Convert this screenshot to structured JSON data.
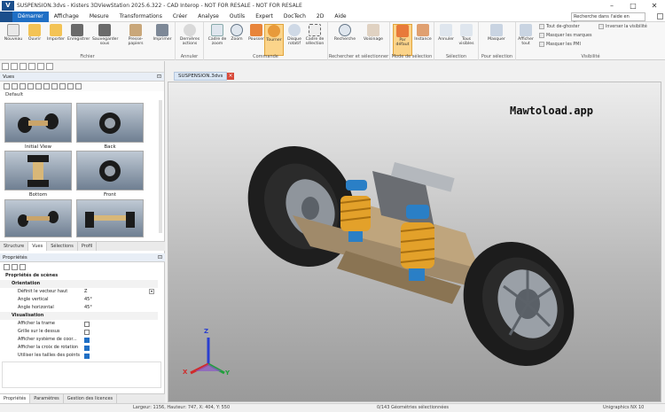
{
  "window": {
    "title": "SUSPENSION.3dvs - Kisters 3DViewStation 2025.6.322 - CAD Interop - NOT FOR RESALE - NOT FOR RESALE",
    "logo": "V",
    "controls": [
      "–",
      "□",
      "✕"
    ]
  },
  "menu": {
    "tabs": [
      "Démarrer",
      "Affichage",
      "Mesure",
      "Transformations",
      "Créer",
      "Analyse",
      "Outils",
      "Expert",
      "DocTech",
      "2D",
      "Aide"
    ],
    "search": "Recherche dans l'aide en ligne..."
  },
  "ribbon": {
    "fichier": {
      "label": "Fichier",
      "buttons": [
        "Nouveau",
        "Ouvrir",
        "Importer",
        "Enregistrer",
        "Sauvegarder sous",
        "Presse-papiers",
        "Imprimer"
      ]
    },
    "annuler": {
      "label": "Annuler",
      "buttons": [
        "Dernières actions"
      ]
    },
    "commande": {
      "label": "Commande",
      "buttons": [
        "Cadre de zoom",
        "Zoom",
        "Pousser",
        "Tourner",
        "Disque rotatif",
        "Cadre de sélection"
      ]
    },
    "recherche": {
      "label": "Rechercher et sélectionner",
      "buttons": [
        "Recherche",
        "Voisinage"
      ]
    },
    "mode": {
      "label": "Mode de sélection",
      "buttons": [
        "Par défaut",
        "Instance"
      ]
    },
    "selection": {
      "label": "Sélection",
      "buttons": [
        "Annuler",
        "Tous visibles"
      ]
    },
    "pour_selection": {
      "label": "Pour sélection",
      "buttons": [
        "Masquer"
      ]
    },
    "visibilite": {
      "label": "Visibilité",
      "buttons": [
        "Afficher tout"
      ],
      "items": [
        "Tout de-ghoster",
        "Masquer les marques",
        "Masquer les PMI",
        "Inverser la visibilité"
      ]
    }
  },
  "left": {
    "views_header": "Vues",
    "default_label": "Default",
    "thumbs": [
      "Initial View",
      "Back",
      "Bottom",
      "Front",
      "",
      ""
    ],
    "tabs": [
      "Structure",
      "Vues",
      "Sélections",
      "Profil"
    ]
  },
  "props": {
    "header": "Propriétés",
    "title": "Propriétés de scènes",
    "sections": {
      "orientation": "Orientation",
      "visualisation": "Visualisation"
    },
    "rows": {
      "up_vector": {
        "k": "Définit le vecteur haut",
        "v": "Z"
      },
      "vertical": {
        "k": "Angle vertical",
        "v": "45°"
      },
      "horizontal": {
        "k": "Angle horizontal",
        "v": "45°"
      },
      "frame": {
        "k": "Afficher la trame",
        "on": false
      },
      "grid": {
        "k": "Grille sur le dessus",
        "on": false
      },
      "coord": {
        "k": "Afficher système de coor...",
        "on": true
      },
      "rotcross": {
        "k": "Afficher la croix de rotation",
        "on": true
      },
      "pointsize": {
        "k": "Utiliser les tailles des points",
        "on": true
      }
    },
    "tabs": [
      "Propriétés",
      "Paramètres",
      "Gestion des licences"
    ]
  },
  "document": {
    "tab": "SUSPENSION.3dvs"
  },
  "viewport": {
    "watermark": "Mawtoload.app",
    "axes": {
      "z": "Z",
      "x": "X",
      "y": "Y"
    }
  },
  "status": {
    "left": "Largeur: 1156, Hauteur: 747, X: 404, Y: 550",
    "middle": "0/143 Géométries sélectionnées",
    "right": "Unigraphics NX 10"
  },
  "colors": {
    "accent": "#1f6fc5",
    "active_button": "#fbd48a"
  }
}
